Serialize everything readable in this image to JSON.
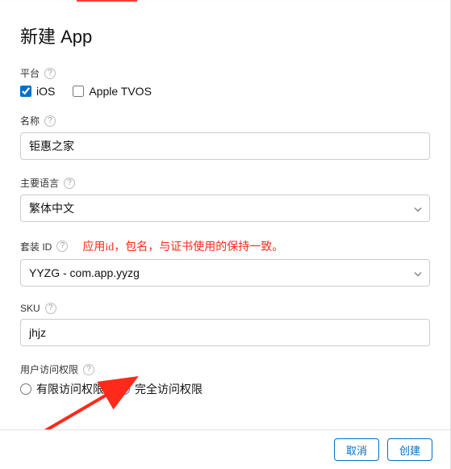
{
  "title": "新建 App",
  "platform": {
    "label": "平台",
    "ios": "iOS",
    "tvos": "Apple TVOS"
  },
  "name": {
    "label": "名称",
    "value": "钜惠之家"
  },
  "language": {
    "label": "主要语言",
    "value": "繁体中文"
  },
  "bundle": {
    "label": "套装 ID",
    "annotation": "应用id，包名，与证书使用的保持一致。",
    "value": "YYZG - com.app.yyzg"
  },
  "sku": {
    "label": "SKU",
    "value": "jhjz"
  },
  "access": {
    "label": "用户访问权限",
    "limited": "有限访问权限",
    "full": "完全访问权限"
  },
  "footer": {
    "cancel": "取消",
    "create": "创建"
  },
  "help_char": "?"
}
